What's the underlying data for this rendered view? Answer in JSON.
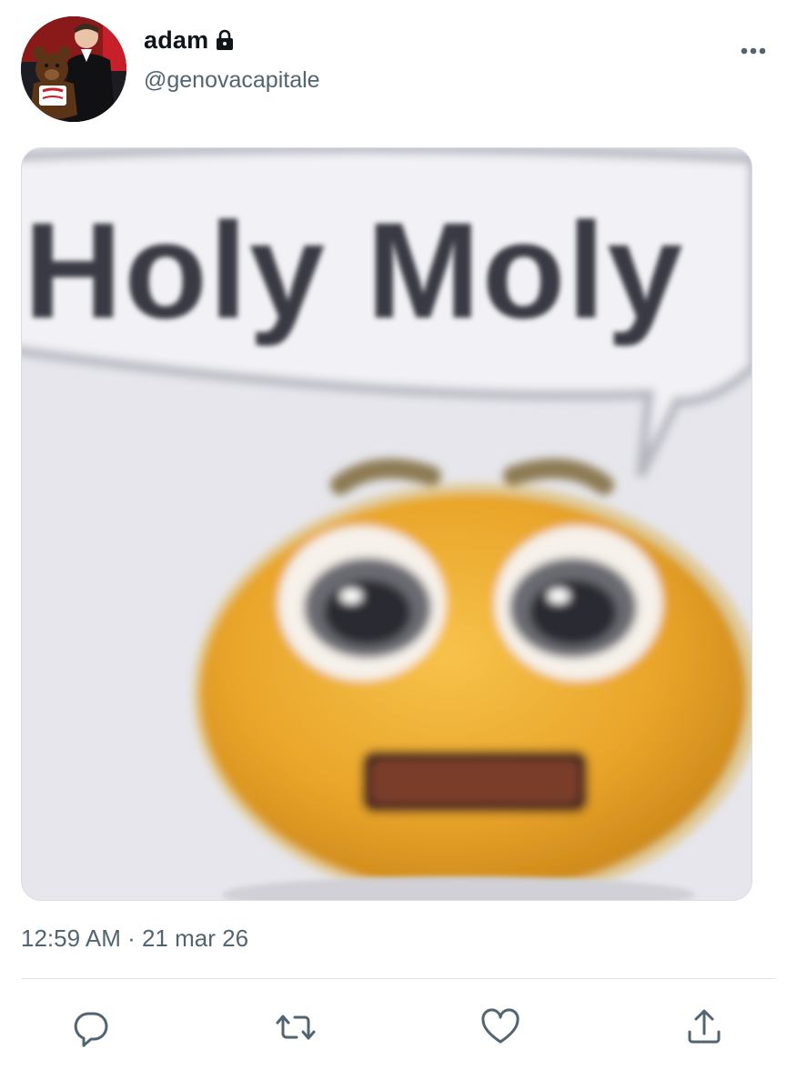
{
  "author": {
    "display_name": "adam",
    "handle": "@genovacapitale",
    "protected": true
  },
  "media": {
    "caption_text": "Holy Moly",
    "subject": "shocked yellow emoji with speech bubble"
  },
  "timestamp": {
    "time": "12:59 AM",
    "separator": " · ",
    "date": "21 mar 26"
  },
  "icons": {
    "lock": "lock-icon",
    "more": "more-icon",
    "reply": "reply-icon",
    "retweet": "retweet-icon",
    "like": "heart-icon",
    "share": "share-icon"
  },
  "colors": {
    "text_primary": "#0f1419",
    "text_secondary": "#536471",
    "divider": "#dfe3e6"
  }
}
